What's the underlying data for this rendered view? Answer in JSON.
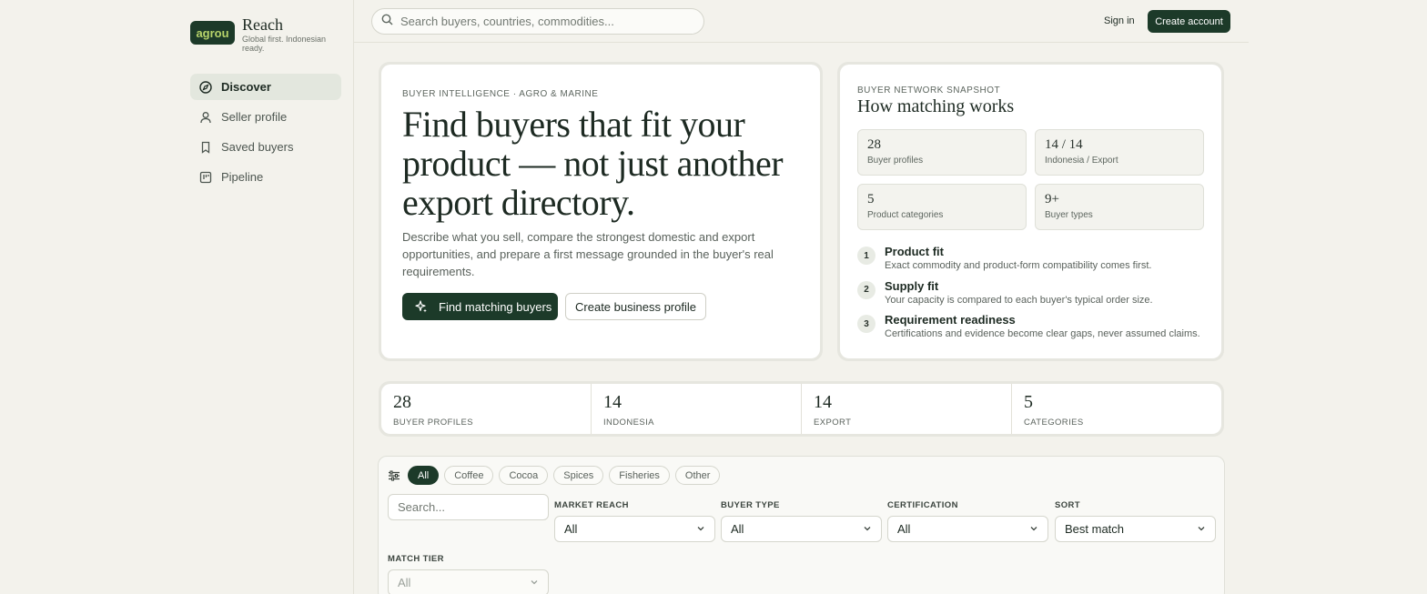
{
  "brand": {
    "logo": "agrou",
    "name": "Reach",
    "tagline": "Global first. Indonesian ready."
  },
  "nav": [
    {
      "label": "Discover",
      "icon": "compass-icon",
      "active": true
    },
    {
      "label": "Seller profile",
      "icon": "user-icon"
    },
    {
      "label": "Saved buyers",
      "icon": "bookmark-icon"
    },
    {
      "label": "Pipeline",
      "icon": "kanban-icon"
    }
  ],
  "topbar": {
    "search_placeholder": "Search buyers, countries, commodities...",
    "signin": "Sign in",
    "create_account": "Create account"
  },
  "hero": {
    "eyebrow": "BUYER INTELLIGENCE · AGRO & MARINE",
    "title": "Find buyers that fit your product — not just another export directory.",
    "description": "Describe what you sell, compare the strongest domestic and export opportunities, and prepare a first message grounded in the buyer's real requirements.",
    "primary_button": "Find matching buyers",
    "secondary_button": "Create business profile"
  },
  "snapshot": {
    "eyebrow": "BUYER NETWORK SNAPSHOT",
    "title": "How matching works",
    "stats": [
      {
        "value": "28",
        "label": "Buyer profiles"
      },
      {
        "value": "14 / 14",
        "label": "Indonesia / Export"
      },
      {
        "value": "5",
        "label": "Product categories"
      },
      {
        "value": "9+",
        "label": "Buyer types"
      }
    ],
    "steps": [
      {
        "num": "1",
        "title": "Product fit",
        "desc": "Exact commodity and product-form compatibility comes first."
      },
      {
        "num": "2",
        "title": "Supply fit",
        "desc": "Your capacity is compared to each buyer's typical order size."
      },
      {
        "num": "3",
        "title": "Requirement readiness",
        "desc": "Certifications and evidence become clear gaps, never assumed claims."
      }
    ]
  },
  "strip": [
    {
      "value": "28",
      "label": "BUYER PROFILES"
    },
    {
      "value": "14",
      "label": "INDONESIA"
    },
    {
      "value": "14",
      "label": "EXPORT"
    },
    {
      "value": "5",
      "label": "CATEGORIES"
    }
  ],
  "filters": {
    "chips": [
      "All",
      "Coffee",
      "Cocoa",
      "Spices",
      "Fisheries",
      "Other"
    ],
    "active_chip": "All",
    "search_placeholder": "Search...",
    "market_reach": {
      "label": "MARKET REACH",
      "value": "All"
    },
    "buyer_type": {
      "label": "BUYER TYPE",
      "value": "All"
    },
    "certification": {
      "label": "CERTIFICATION",
      "value": "All"
    },
    "sort": {
      "label": "SORT",
      "value": "Best match"
    },
    "match_tier": {
      "label": "MATCH TIER",
      "value": "All"
    }
  }
}
